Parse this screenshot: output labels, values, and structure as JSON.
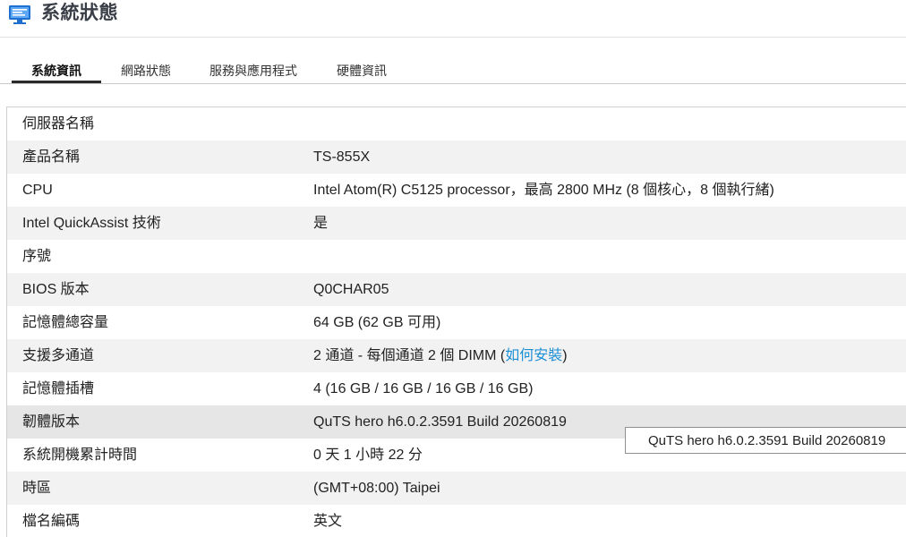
{
  "header": {
    "title": "系統狀態",
    "icon": "monitor-icon"
  },
  "tabs": [
    {
      "label": "系統資訊",
      "active": true
    },
    {
      "label": "網路狀態",
      "active": false
    },
    {
      "label": "服務與應用程式",
      "active": false
    },
    {
      "label": "硬體資訊",
      "active": false
    }
  ],
  "info": {
    "server_name": {
      "label": "伺服器名稱",
      "value": ""
    },
    "product_name": {
      "label": "產品名稱",
      "value": "TS-855X"
    },
    "cpu": {
      "label": "CPU",
      "value": "Intel Atom(R) C5125 processor，最高 2800 MHz (8 個核心，8 個執行緒)"
    },
    "quickassist": {
      "label": "Intel QuickAssist 技術",
      "value": "是"
    },
    "serial": {
      "label": "序號",
      "value": ""
    },
    "bios": {
      "label": "BIOS 版本",
      "value": "Q0CHAR05"
    },
    "memory_total": {
      "label": "記憶體總容量",
      "value": "64 GB (62 GB 可用)"
    },
    "multichannel": {
      "label": "支援多通道",
      "value_prefix": "2 通道 - 每個通道 2 個 DIMM (",
      "link": "如何安裝",
      "value_suffix": ")"
    },
    "memory_slots": {
      "label": "記憶體插槽",
      "value": "4 (16 GB / 16 GB / 16 GB / 16 GB)"
    },
    "firmware": {
      "label": "韌體版本",
      "value": "QuTS hero h6.0.2.3591 Build 20260819"
    },
    "uptime": {
      "label": "系統開機累計時間",
      "value": "0 天 1 小時 22 分"
    },
    "timezone": {
      "label": "時區",
      "value": "(GMT+08:00) Taipei"
    },
    "filename_encoding": {
      "label": "檔名編碼",
      "value": "英文"
    }
  },
  "tooltip": {
    "text": "QuTS hero h6.0.2.3591 Build 20260819"
  },
  "colors": {
    "link": "#1b8fd6",
    "row_alt": "#f2f2f2",
    "row_hover": "#e6e6e6"
  }
}
